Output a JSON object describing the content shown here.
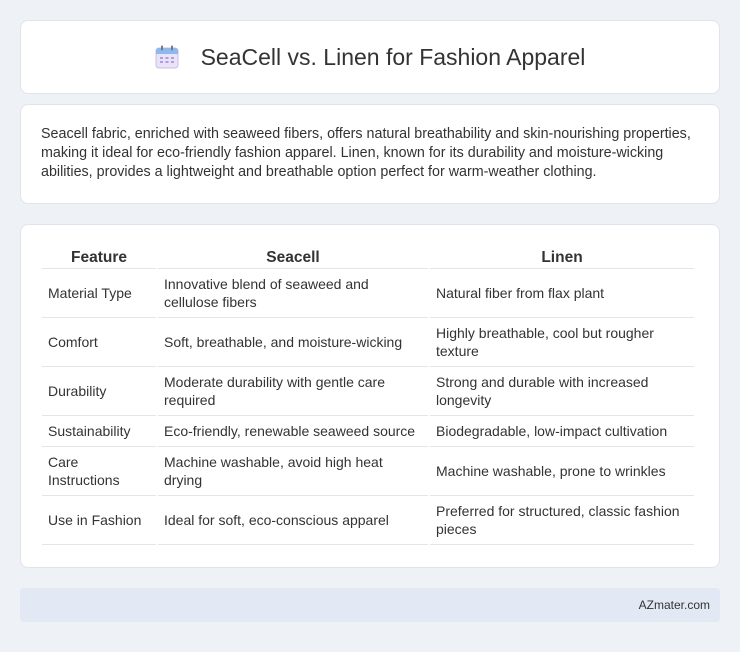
{
  "header": {
    "title": "SeaCell vs. Linen for Fashion Apparel",
    "icon": "calendar-icon"
  },
  "intro": {
    "text": "Seacell fabric, enriched with seaweed fibers, offers natural breathability and skin-nourishing properties, making it ideal for eco-friendly fashion apparel. Linen, known for its durability and moisture-wicking abilities, provides a lightweight and breathable option perfect for warm-weather clothing."
  },
  "table": {
    "headers": [
      "Feature",
      "Seacell",
      "Linen"
    ],
    "rows": [
      [
        "Material Type",
        "Innovative blend of seaweed and cellulose fibers",
        "Natural fiber from flax plant"
      ],
      [
        "Comfort",
        "Soft, breathable, and moisture-wicking",
        "Highly breathable, cool but rougher texture"
      ],
      [
        "Durability",
        "Moderate durability with gentle care required",
        "Strong and durable with increased longevity"
      ],
      [
        "Sustainability",
        "Eco-friendly, renewable seaweed source",
        "Biodegradable, low-impact cultivation"
      ],
      [
        "Care Instructions",
        "Machine washable, avoid high heat drying",
        "Machine washable, prone to wrinkles"
      ],
      [
        "Use in Fashion",
        "Ideal for soft, eco-conscious apparel",
        "Preferred for structured, classic fashion pieces"
      ]
    ]
  },
  "footer": {
    "text": "AZmater.com"
  }
}
